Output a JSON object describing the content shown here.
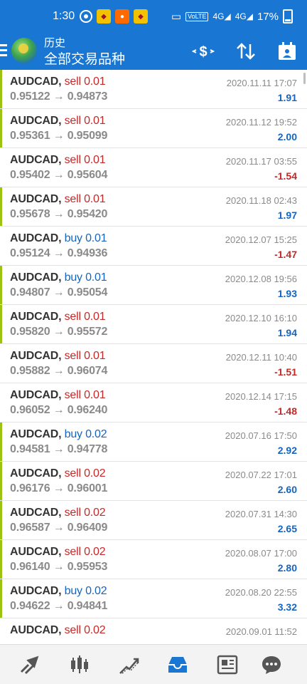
{
  "statusbar": {
    "time": "1:30",
    "battery": "17%",
    "net1": "VoLTE",
    "net2": "4G",
    "net3": "4G"
  },
  "header": {
    "subtitle": "历史",
    "title": "全部交易品种"
  },
  "trades": [
    {
      "symbol": "AUDCAD,",
      "side": "sell",
      "volume": "0.01",
      "open": "0.95122",
      "close": "0.94873",
      "date": "2020.11.11 17:07",
      "profit": "1.91"
    },
    {
      "symbol": "AUDCAD,",
      "side": "sell",
      "volume": "0.01",
      "open": "0.95361",
      "close": "0.95099",
      "date": "2020.11.12 19:52",
      "profit": "2.00"
    },
    {
      "symbol": "AUDCAD,",
      "side": "sell",
      "volume": "0.01",
      "open": "0.95402",
      "close": "0.95604",
      "date": "2020.11.17 03:55",
      "profit": "-1.54"
    },
    {
      "symbol": "AUDCAD,",
      "side": "sell",
      "volume": "0.01",
      "open": "0.95678",
      "close": "0.95420",
      "date": "2020.11.18 02:43",
      "profit": "1.97"
    },
    {
      "symbol": "AUDCAD,",
      "side": "buy",
      "volume": "0.01",
      "open": "0.95124",
      "close": "0.94936",
      "date": "2020.12.07 15:25",
      "profit": "-1.47"
    },
    {
      "symbol": "AUDCAD,",
      "side": "buy",
      "volume": "0.01",
      "open": "0.94807",
      "close": "0.95054",
      "date": "2020.12.08 19:56",
      "profit": "1.93"
    },
    {
      "symbol": "AUDCAD,",
      "side": "sell",
      "volume": "0.01",
      "open": "0.95820",
      "close": "0.95572",
      "date": "2020.12.10 16:10",
      "profit": "1.94"
    },
    {
      "symbol": "AUDCAD,",
      "side": "sell",
      "volume": "0.01",
      "open": "0.95882",
      "close": "0.96074",
      "date": "2020.12.11 10:40",
      "profit": "-1.51"
    },
    {
      "symbol": "AUDCAD,",
      "side": "sell",
      "volume": "0.01",
      "open": "0.96052",
      "close": "0.96240",
      "date": "2020.12.14 17:15",
      "profit": "-1.48"
    },
    {
      "symbol": "AUDCAD,",
      "side": "buy",
      "volume": "0.02",
      "open": "0.94581",
      "close": "0.94778",
      "date": "2020.07.16 17:50",
      "profit": "2.92"
    },
    {
      "symbol": "AUDCAD,",
      "side": "sell",
      "volume": "0.02",
      "open": "0.96176",
      "close": "0.96001",
      "date": "2020.07.22 17:01",
      "profit": "2.60"
    },
    {
      "symbol": "AUDCAD,",
      "side": "sell",
      "volume": "0.02",
      "open": "0.96587",
      "close": "0.96409",
      "date": "2020.07.31 14:30",
      "profit": "2.65"
    },
    {
      "symbol": "AUDCAD,",
      "side": "sell",
      "volume": "0.02",
      "open": "0.96140",
      "close": "0.95953",
      "date": "2020.08.07 17:00",
      "profit": "2.80"
    },
    {
      "symbol": "AUDCAD,",
      "side": "buy",
      "volume": "0.02",
      "open": "0.94622",
      "close": "0.94841",
      "date": "2020.08.20 22:55",
      "profit": "3.32"
    },
    {
      "symbol": "AUDCAD,",
      "side": "sell",
      "volume": "0.02",
      "open": "",
      "close": "",
      "date": "2020.09.01 11:52",
      "profit": ""
    }
  ],
  "colors": {
    "accent": "#1976d2",
    "sell": "#c62828",
    "buy": "#1565c0",
    "profit_bar": "#9cc30f"
  },
  "bottomnav": [
    "quotes-icon",
    "chart-icon",
    "trade-icon",
    "history-icon",
    "news-icon",
    "chat-icon"
  ]
}
